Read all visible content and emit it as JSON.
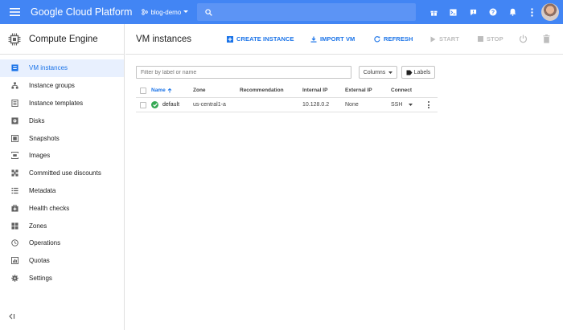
{
  "topbar": {
    "brand": "Google Cloud Platform",
    "project": "blog-demo",
    "search_placeholder": "",
    "icons": [
      "menu-icon",
      "search-icon",
      "gift-icon",
      "console-icon",
      "alert-icon",
      "help-icon",
      "notifications-icon",
      "more-vert-icon"
    ],
    "accent": "#4285f4"
  },
  "sidebar": {
    "product": "Compute Engine",
    "items": [
      {
        "label": "VM instances",
        "icon": "vm-instances-icon",
        "active": true
      },
      {
        "label": "Instance groups",
        "icon": "instance-groups-icon"
      },
      {
        "label": "Instance templates",
        "icon": "instance-templates-icon"
      },
      {
        "label": "Disks",
        "icon": "disks-icon"
      },
      {
        "label": "Snapshots",
        "icon": "snapshots-icon"
      },
      {
        "label": "Images",
        "icon": "images-icon"
      },
      {
        "label": "Committed use discounts",
        "icon": "committed-use-icon"
      },
      {
        "label": "Metadata",
        "icon": "metadata-icon"
      },
      {
        "label": "Health checks",
        "icon": "health-checks-icon"
      },
      {
        "label": "Zones",
        "icon": "zones-icon"
      },
      {
        "label": "Operations",
        "icon": "operations-icon"
      },
      {
        "label": "Quotas",
        "icon": "quotas-icon"
      },
      {
        "label": "Settings",
        "icon": "settings-icon"
      }
    ],
    "collapse_label": "<|"
  },
  "main": {
    "title": "VM instances",
    "actions": {
      "create": "CREATE INSTANCE",
      "import": "IMPORT VM",
      "refresh": "REFRESH",
      "start": "START",
      "stop": "STOP"
    },
    "filter_placeholder": "Filter by label or name",
    "columns_label": "Columns",
    "labels_label": "Labels",
    "table": {
      "headers": {
        "name": "Name",
        "zone": "Zone",
        "recommendation": "Recommendation",
        "internal_ip": "Internal IP",
        "external_ip": "External IP",
        "connect": "Connect"
      },
      "rows": [
        {
          "name": "default",
          "zone": "us-central1-a",
          "recommendation": "",
          "internal_ip": "10.128.0.2",
          "external_ip": "None",
          "connect": "SSH",
          "status": "running"
        }
      ]
    }
  },
  "colors": {
    "accent_blue": "#1a73e8",
    "status_green": "#34a853",
    "disabled": "#bdbdbd"
  }
}
